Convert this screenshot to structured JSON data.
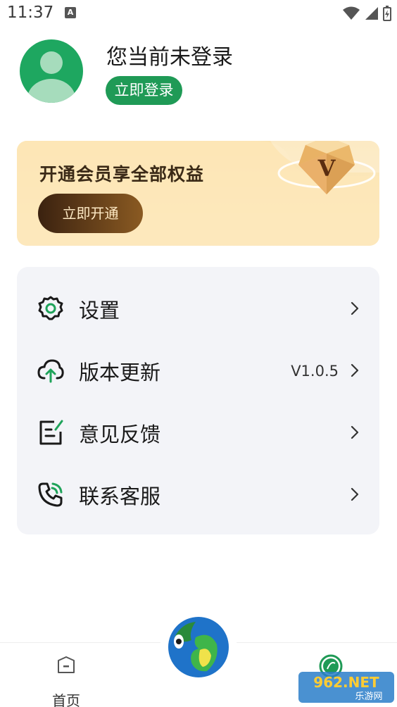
{
  "status_bar": {
    "time": "11:37",
    "notification_icon_letter": "A"
  },
  "profile": {
    "username": "您当前未登录",
    "login_label": "立即登录"
  },
  "vip_banner": {
    "title": "开通会员享全部权益",
    "button_label": "立即开通",
    "badge_letter": "V"
  },
  "menu": {
    "items": [
      {
        "label": "设置",
        "icon": "gear-icon",
        "value": ""
      },
      {
        "label": "版本更新",
        "icon": "cloud-upload-icon",
        "value": "V1.0.5"
      },
      {
        "label": "意见反馈",
        "icon": "feedback-edit-icon",
        "value": ""
      },
      {
        "label": "联系客服",
        "icon": "phone-call-icon",
        "value": ""
      }
    ]
  },
  "bottom_nav": {
    "home_label": "首页"
  },
  "watermark": {
    "brand": "962.NET",
    "subtitle": "乐游网"
  },
  "colors": {
    "accent_green": "#1f9a56",
    "avatar_green": "#1ea760",
    "vip_gold": "#fbe3b0",
    "vip_brown": "#3b2210"
  }
}
